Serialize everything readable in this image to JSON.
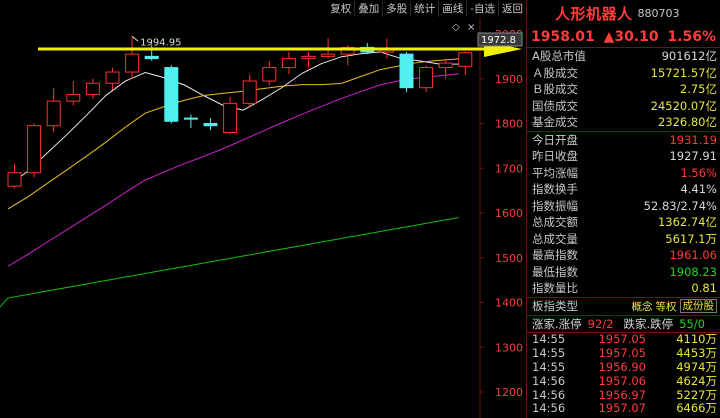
{
  "toolbar": {
    "buttons": [
      "复权",
      "叠加",
      "多股",
      "统计",
      "画线",
      "-自选",
      "返回"
    ]
  },
  "chart": {
    "y_ticks": [
      "2000",
      "1900",
      "1800",
      "1700",
      "1600",
      "1500",
      "1400",
      "1300",
      "1200"
    ],
    "price_box": "1972.8",
    "high_label": "1994.95",
    "colors": {
      "up": "#ff3030",
      "down": "#50f0f0",
      "ma5": "#e8e8e8",
      "ma10": "#e8c020",
      "ma20": "#d020d0",
      "ma60": "#10c010",
      "arrow": "#f0f000"
    }
  },
  "chart_data": {
    "type": "candlestick",
    "ylim": [
      1200,
      2000
    ],
    "candles": [
      {
        "o": 1660,
        "h": 1710,
        "l": 1655,
        "c": 1690
      },
      {
        "o": 1690,
        "h": 1800,
        "l": 1680,
        "c": 1795
      },
      {
        "o": 1795,
        "h": 1880,
        "l": 1780,
        "c": 1850
      },
      {
        "o": 1850,
        "h": 1895,
        "l": 1840,
        "c": 1865
      },
      {
        "o": 1865,
        "h": 1900,
        "l": 1855,
        "c": 1890
      },
      {
        "o": 1890,
        "h": 1925,
        "l": 1875,
        "c": 1915
      },
      {
        "o": 1915,
        "h": 1994.95,
        "l": 1900,
        "c": 1955
      },
      {
        "o": 1950,
        "h": 1975,
        "l": 1940,
        "c": 1945
      },
      {
        "o": 1925,
        "h": 1930,
        "l": 1800,
        "c": 1805
      },
      {
        "o": 1812,
        "h": 1820,
        "l": 1790,
        "c": 1810
      },
      {
        "o": 1800,
        "h": 1812,
        "l": 1785,
        "c": 1795
      },
      {
        "o": 1780,
        "h": 1860,
        "l": 1775,
        "c": 1845
      },
      {
        "o": 1845,
        "h": 1910,
        "l": 1835,
        "c": 1895
      },
      {
        "o": 1895,
        "h": 1940,
        "l": 1885,
        "c": 1925
      },
      {
        "o": 1925,
        "h": 1960,
        "l": 1910,
        "c": 1945
      },
      {
        "o": 1945,
        "h": 1960,
        "l": 1925,
        "c": 1950
      },
      {
        "o": 1950,
        "h": 1990,
        "l": 1945,
        "c": 1955
      },
      {
        "o": 1955,
        "h": 1975,
        "l": 1930,
        "c": 1970
      },
      {
        "o": 1970,
        "h": 1980,
        "l": 1955,
        "c": 1960
      },
      {
        "o": 1960,
        "h": 1990,
        "l": 1945,
        "c": 1965
      },
      {
        "o": 1955,
        "h": 1960,
        "l": 1870,
        "c": 1880
      },
      {
        "o": 1880,
        "h": 1930,
        "l": 1870,
        "c": 1925
      },
      {
        "o": 1925,
        "h": 1945,
        "l": 1900,
        "c": 1935
      },
      {
        "o": 1927.91,
        "h": 1961.06,
        "l": 1908.23,
        "c": 1958.01
      }
    ]
  },
  "panel": {
    "name": "人形机器人",
    "code": "880703",
    "price": "1958.01",
    "change": "▲30.10",
    "change_pct": "1.56%",
    "stats1": [
      {
        "label": "A股总市值",
        "value": "901612亿",
        "color": "white"
      },
      {
        "label": "Ａ股成交",
        "value": "15721.57亿",
        "color": "yellow"
      },
      {
        "label": "Ｂ股成交",
        "value": "2.75亿",
        "color": "yellow"
      },
      {
        "label": "国债成交",
        "value": "24520.07亿",
        "color": "yellow"
      },
      {
        "label": "基金成交",
        "value": "2326.80亿",
        "color": "yellow"
      }
    ],
    "stats2": [
      {
        "label": "今日开盘",
        "value": "1931.19",
        "color": "red"
      },
      {
        "label": "昨日收盘",
        "value": "1927.91",
        "color": "white"
      },
      {
        "label": "平均涨幅",
        "value": "1.56%",
        "color": "red"
      },
      {
        "label": "指数换手",
        "value": "4.41%",
        "color": "white"
      },
      {
        "label": "指数振幅",
        "value": "52.83/2.74%",
        "color": "white"
      },
      {
        "label": "总成交额",
        "value": "1362.74亿",
        "color": "yellow"
      },
      {
        "label": "总成交量",
        "value": "5617.1万",
        "color": "yellow"
      },
      {
        "label": "最高指数",
        "value": "1961.06",
        "color": "red"
      },
      {
        "label": "最低指数",
        "value": "1908.23",
        "color": "green"
      },
      {
        "label": "指数量比",
        "value": "0.81",
        "color": "yellow"
      }
    ],
    "type_label": "板指类型",
    "tags": [
      "概念",
      "等权",
      "成份股"
    ],
    "advance_label": "涨家.涨停",
    "advance_value": "92/2",
    "decline_label": "跌家.跌停",
    "decline_value": "55/0",
    "ticks": [
      {
        "time": "14:55",
        "price": "1957.05",
        "vol": "4110万"
      },
      {
        "time": "14:55",
        "price": "1957.05",
        "vol": "4453万"
      },
      {
        "time": "14:55",
        "price": "1956.90",
        "vol": "4974万"
      },
      {
        "time": "14:56",
        "price": "1957.06",
        "vol": "4624万"
      },
      {
        "time": "14:56",
        "price": "1956.97",
        "vol": "5227万"
      },
      {
        "time": "14:56",
        "price": "1957.07",
        "vol": "6466万"
      }
    ]
  }
}
